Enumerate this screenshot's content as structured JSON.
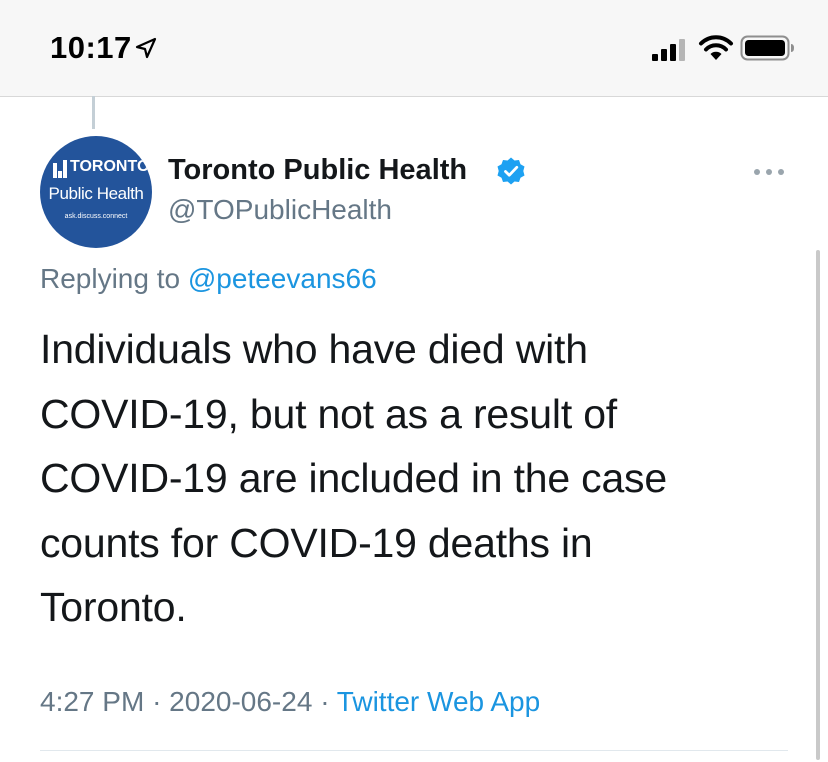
{
  "status_bar": {
    "time": "10:17",
    "icons": [
      "location-arrow-icon",
      "cellular-signal-icon",
      "wifi-icon",
      "battery-icon"
    ]
  },
  "tweet": {
    "author": {
      "display_name": "Toronto Public Health",
      "handle": "@TOPublicHealth",
      "verified": true,
      "avatar_logo": {
        "word": "TORONTO",
        "subtitle": "Public Health",
        "tagline": "ask.discuss.connect"
      }
    },
    "replying_to_label": "Replying to",
    "replying_to_handle": "@peteevans66",
    "text": "Individuals who have died with COVID-19, but not as a result of COVID-19 are included in the case counts for COVID-19 deaths in Toronto.",
    "time": "4:27 PM",
    "separator": "·",
    "date": "2020-06-24",
    "source": "Twitter Web App"
  },
  "colors": {
    "link_blue": "#1b95e0",
    "secondary_text": "#657786",
    "avatar_blue": "#23549b",
    "verified_blue": "#1da1f2"
  }
}
